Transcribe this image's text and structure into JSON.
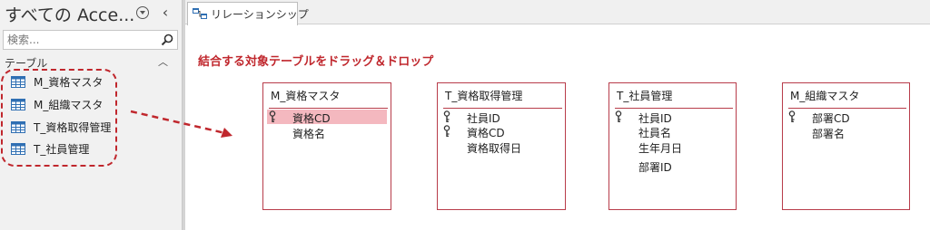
{
  "nav": {
    "title": "すべての Acce...",
    "search_placeholder": "検索...",
    "group_label": "テーブル",
    "items": [
      {
        "label": "M_資格マスタ"
      },
      {
        "label": "M_組織マスタ"
      },
      {
        "label": "T_資格取得管理"
      },
      {
        "label": "T_社員管理"
      }
    ]
  },
  "doc": {
    "tab_label": "リレーションシップ",
    "instruction": "結合する対象テーブルをドラッグ＆ドロップ"
  },
  "tables": [
    {
      "title": "M_資格マスタ",
      "fields": [
        {
          "name": "資格CD",
          "key": true,
          "selected": true
        },
        {
          "name": "資格名",
          "key": false,
          "selected": false
        }
      ]
    },
    {
      "title": "T_資格取得管理",
      "fields": [
        {
          "name": "社員ID",
          "key": true,
          "selected": false
        },
        {
          "name": "資格CD",
          "key": true,
          "selected": false
        },
        {
          "name": "資格取得日",
          "key": false,
          "selected": false
        }
      ]
    },
    {
      "title": "T_社員管理",
      "fields": [
        {
          "name": "社員ID",
          "key": true,
          "selected": false
        },
        {
          "name": "社員名",
          "key": false,
          "selected": false
        },
        {
          "name": "生年月日",
          "key": false,
          "selected": false
        },
        {
          "name": "部署ID",
          "key": false,
          "selected": false
        }
      ]
    },
    {
      "title": "M_組織マスタ",
      "fields": [
        {
          "name": "部署CD",
          "key": true,
          "selected": false
        },
        {
          "name": "部署名",
          "key": false,
          "selected": false
        }
      ]
    }
  ],
  "colors": {
    "annotation_red": "#c0272d",
    "table_border": "#b83c4a",
    "selected_field": "#f4b8bf",
    "nav_background": "#f1f1f1"
  },
  "icons": {
    "nav_menu": "circle-chevron-down-icon",
    "nav_collapse": "chevron-left-icon",
    "search": "search-icon",
    "group_toggle": "chevron-up-icon",
    "table_item": "table-icon",
    "relationships_tab": "relationships-icon",
    "primary_key": "key-icon"
  }
}
